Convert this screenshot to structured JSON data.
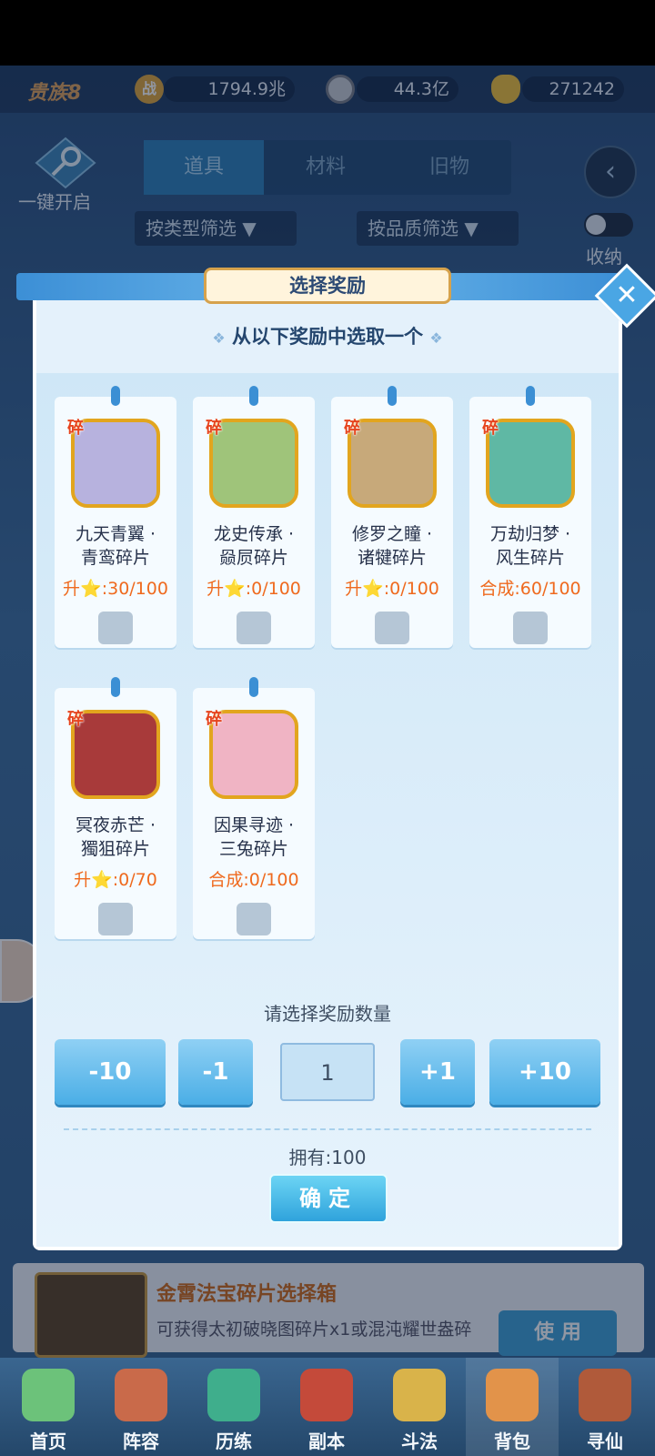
{
  "topbar": {
    "vip": "贵族8",
    "power_icon": "战",
    "power": "1794.9兆",
    "silver": "44.3亿",
    "gold": "271242"
  },
  "header": {
    "key_label": "一键开启",
    "tabs": [
      {
        "label": "道具",
        "active": true
      },
      {
        "label": "材料",
        "active": false
      },
      {
        "label": "旧物",
        "active": false
      }
    ],
    "filter_type": "按类型筛选",
    "filter_quality": "按品质筛选",
    "collapse_label": "收纳"
  },
  "modal": {
    "title": "选择奖励",
    "subtitle": "从以下奖励中选取一个",
    "frag_badge": "碎",
    "rewards": [
      {
        "line1": "九天青翼 ·",
        "line2": "青鸾碎片",
        "progress": "升⭐:30/100",
        "color": "#b7b2de"
      },
      {
        "line1": "龙史传承 ·",
        "line2": "赑屃碎片",
        "progress": "升⭐:0/100",
        "color": "#9fc47a"
      },
      {
        "line1": "修罗之瞳 ·",
        "line2": "诸犍碎片",
        "progress": "升⭐:0/100",
        "color": "#c7a97a"
      },
      {
        "line1": "万劫归梦 ·",
        "line2": "风生碎片",
        "progress": "合成:60/100",
        "color": "#5fb8a4"
      },
      {
        "line1": "冥夜赤芒 ·",
        "line2": "獨狙碎片",
        "progress": "升⭐:0/70",
        "color": "#a83a3a"
      },
      {
        "line1": "因果寻迹 ·",
        "line2": "三兔碎片",
        "progress": "合成:0/100",
        "color": "#f0b4c4"
      }
    ],
    "qty_label": "请选择奖励数量",
    "qty_minus10": "-10",
    "qty_minus1": "-1",
    "qty_value": "1",
    "qty_plus1": "+1",
    "qty_plus10": "+10",
    "own": "拥有:100",
    "confirm": "确定"
  },
  "item": {
    "title": "金霄法宝碎片选择箱",
    "desc": "可获得太初破晓图碎片x1或混沌耀世盎碎",
    "use": "使 用"
  },
  "nav": [
    {
      "label": "首页",
      "color": "#6cc27a",
      "active": false
    },
    {
      "label": "阵容",
      "color": "#c96a4a",
      "active": false
    },
    {
      "label": "历练",
      "color": "#3fae8c",
      "active": false
    },
    {
      "label": "副本",
      "color": "#c44a3a",
      "active": false
    },
    {
      "label": "斗法",
      "color": "#d9b34a",
      "active": false
    },
    {
      "label": "背包",
      "color": "#e2934a",
      "active": true
    },
    {
      "label": "寻仙",
      "color": "#b05a3a",
      "active": false
    }
  ]
}
